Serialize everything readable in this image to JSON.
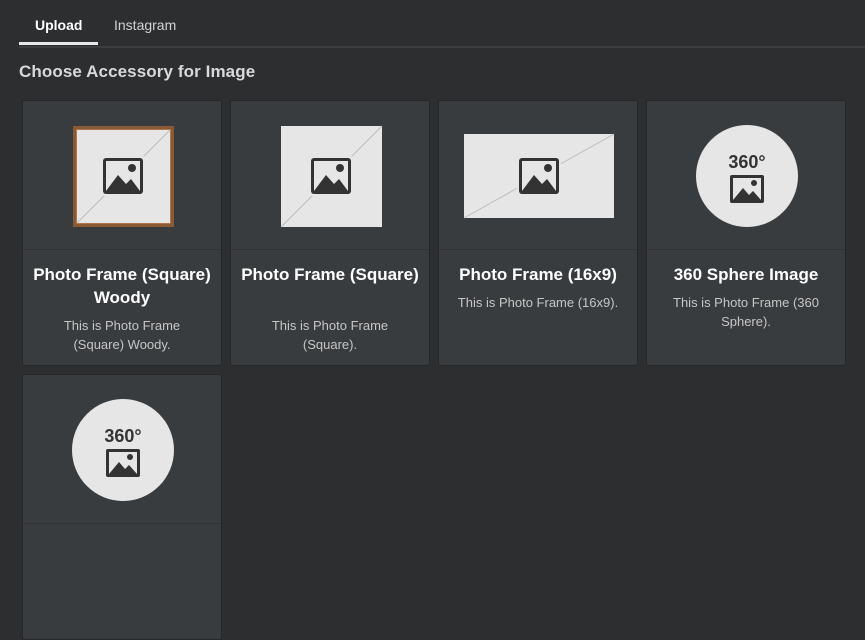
{
  "tabs": [
    {
      "label": "Upload",
      "active": true
    },
    {
      "label": "Instagram",
      "active": false
    }
  ],
  "section_title": "Choose Accessory for Image",
  "cards": [
    {
      "title": "Photo Frame (Square) Woody",
      "description": "This is Photo Frame (Square) Woody.",
      "thumb": "wood-square-frame"
    },
    {
      "title": "Photo Frame (Square)",
      "description": "This is Photo Frame (Square).",
      "thumb": "square-frame"
    },
    {
      "title": "Photo Frame (16x9)",
      "description": "This is Photo Frame (16x9).",
      "thumb": "wide-frame"
    },
    {
      "title": "360 Sphere Image",
      "description": "This is Photo Frame (360 Sphere).",
      "thumb": "sphere",
      "badge": "360°"
    },
    {
      "title": "",
      "description": "",
      "thumb": "sphere",
      "badge": "360°"
    }
  ],
  "colors": {
    "background": "#2c2e30",
    "card": "#393c3f",
    "placeholder": "#e6e6e6",
    "wood": "#8a5a35",
    "icon": "#333333"
  }
}
